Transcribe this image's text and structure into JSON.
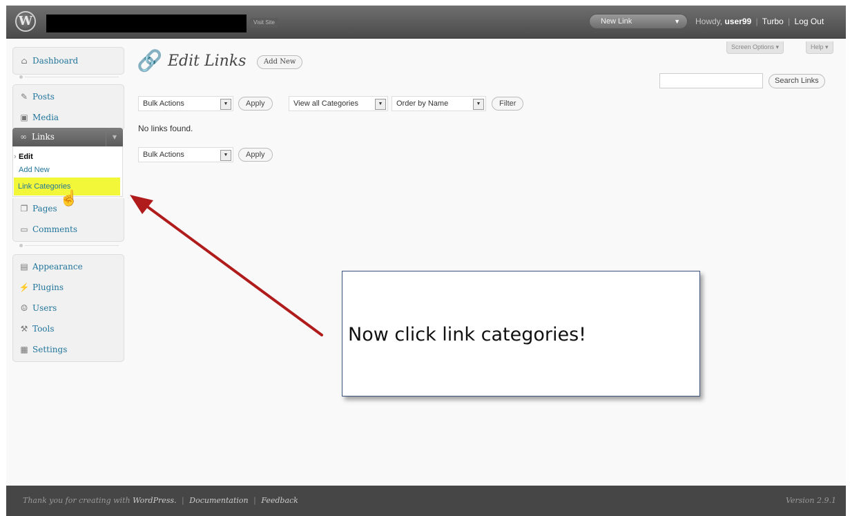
{
  "header": {
    "logo_glyph": "W",
    "visit_site": "Visit Site",
    "favorite_action": "New Link",
    "favorite_toggle": "▼",
    "howdy_prefix": "Howdy,",
    "username": "user99",
    "turbo": "Turbo",
    "logout": "Log Out",
    "separator": "|"
  },
  "screen_meta": {
    "screen_options": "Screen Options ▾",
    "help": "Help ▾"
  },
  "sidebar": {
    "dashboard": {
      "label": "Dashboard",
      "icon": "house-icon"
    },
    "posts": {
      "label": "Posts",
      "icon": "pin-icon"
    },
    "media": {
      "label": "Media",
      "icon": "media-icon"
    },
    "links": {
      "label": "Links",
      "icon": "link-icon",
      "toggle": "▼"
    },
    "links_submenu": {
      "edit": "Edit",
      "add_new": "Add New",
      "link_categories": "Link Categories"
    },
    "pages": {
      "label": "Pages",
      "icon": "pages-icon"
    },
    "comments": {
      "label": "Comments",
      "icon": "comment-icon"
    },
    "appearance": {
      "label": "Appearance",
      "icon": "appearance-icon"
    },
    "plugins": {
      "label": "Plugins",
      "icon": "plug-icon"
    },
    "users": {
      "label": "Users",
      "icon": "users-icon"
    },
    "tools": {
      "label": "Tools",
      "icon": "tools-icon"
    },
    "settings": {
      "label": "Settings",
      "icon": "settings-icon"
    }
  },
  "main": {
    "title": "Edit Links",
    "add_new": "Add New",
    "search_button": "Search Links",
    "search_value": "",
    "top_bulk_actions": "Bulk Actions",
    "top_apply": "Apply",
    "category_filter": "View all Categories",
    "order_by": "Order by Name",
    "filter": "Filter",
    "empty_message": "No links found.",
    "bottom_bulk_actions": "Bulk Actions",
    "bottom_apply": "Apply"
  },
  "callout": {
    "text": "Now click link categories!",
    "arrow_color": "#b01c1c"
  },
  "footer": {
    "thanks": "Thank you for creating with",
    "wordpress": "WordPress.",
    "documentation": "Documentation",
    "feedback": "Feedback",
    "separator": "|",
    "version": "Version 2.9.1"
  },
  "colors": {
    "link": "#21759b",
    "header_bg": "#5a5a5a",
    "highlight": "#f3f73a",
    "footer_bg": "#464646"
  }
}
